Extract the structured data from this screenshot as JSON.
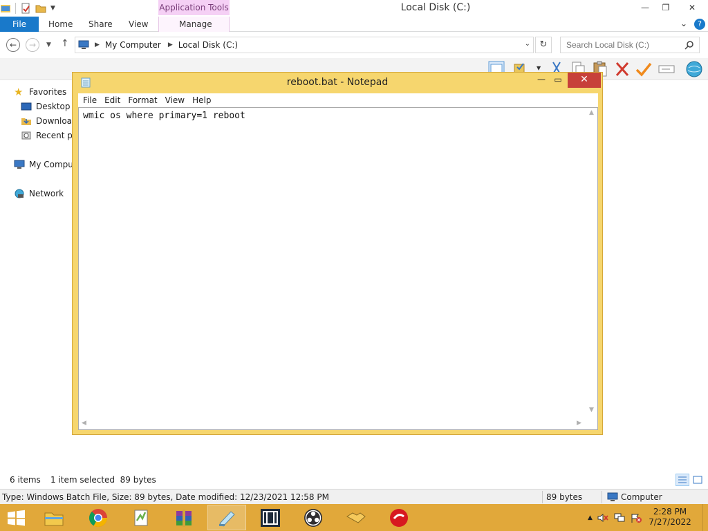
{
  "explorer": {
    "window_title": "Local Disk (C:)",
    "context_tab": "Application Tools",
    "ribbon_tabs": [
      "File",
      "Home",
      "Share",
      "View",
      "Manage"
    ],
    "address": {
      "crumbs": [
        "My Computer",
        "Local Disk (C:)"
      ]
    },
    "search_placeholder": "Search Local Disk (C:)",
    "nav_pane": {
      "favorites": "Favorites",
      "desktop": "Desktop",
      "downloads": "Download",
      "recent": "Recent pla",
      "computer": "My Comput",
      "network": "Network"
    },
    "status": {
      "items": "6 items",
      "selected": "1 item selected  89 bytes"
    },
    "details": {
      "info": "Type: Windows Batch File, Size: 89 bytes, Date modified: 12/23/2021 12:58 PM",
      "size": "89 bytes",
      "location": "Computer"
    }
  },
  "notepad": {
    "title": "reboot.bat - Notepad",
    "menu": [
      "File",
      "Edit",
      "Format",
      "View",
      "Help"
    ],
    "content": "wmic os where primary=1 reboot"
  },
  "taskbar": {
    "time": "2:28 PM",
    "date": "7/27/2022"
  },
  "colors": {
    "notepad_frame": "#f6d66e",
    "taskbar": "#e1a83a",
    "file_tab": "#1979ca",
    "close_button": "#c7403a"
  }
}
